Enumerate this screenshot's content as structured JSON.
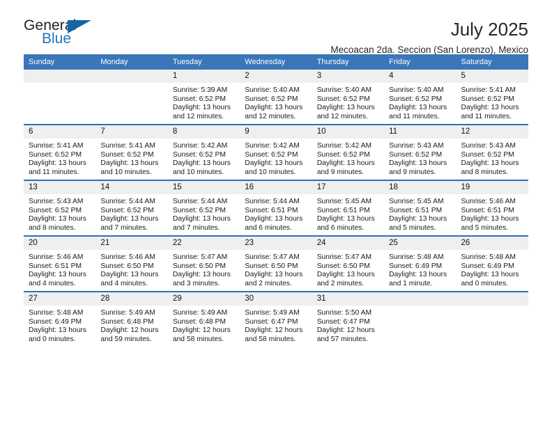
{
  "brand": {
    "name_part1": "General",
    "name_part2": "Blue"
  },
  "header": {
    "title": "July 2025",
    "subtitle": "Mecoacan 2da. Seccion (San Lorenzo), Mexico"
  },
  "colors": {
    "header_blue": "#3a76b8",
    "row_divider_blue": "#2f6fb2",
    "daynum_band": "#efefef",
    "brand_blue": "#1f76bc",
    "text": "#1a1a1a"
  },
  "calendar": {
    "weekday_headers": [
      "Sunday",
      "Monday",
      "Tuesday",
      "Wednesday",
      "Thursday",
      "Friday",
      "Saturday"
    ],
    "weeks": [
      [
        {
          "day": "",
          "empty": true
        },
        {
          "day": "",
          "empty": true
        },
        {
          "day": "1",
          "sunrise": "Sunrise: 5:39 AM",
          "sunset": "Sunset: 6:52 PM",
          "daylight": "Daylight: 13 hours and 12 minutes."
        },
        {
          "day": "2",
          "sunrise": "Sunrise: 5:40 AM",
          "sunset": "Sunset: 6:52 PM",
          "daylight": "Daylight: 13 hours and 12 minutes."
        },
        {
          "day": "3",
          "sunrise": "Sunrise: 5:40 AM",
          "sunset": "Sunset: 6:52 PM",
          "daylight": "Daylight: 13 hours and 12 minutes."
        },
        {
          "day": "4",
          "sunrise": "Sunrise: 5:40 AM",
          "sunset": "Sunset: 6:52 PM",
          "daylight": "Daylight: 13 hours and 11 minutes."
        },
        {
          "day": "5",
          "sunrise": "Sunrise: 5:41 AM",
          "sunset": "Sunset: 6:52 PM",
          "daylight": "Daylight: 13 hours and 11 minutes."
        }
      ],
      [
        {
          "day": "6",
          "sunrise": "Sunrise: 5:41 AM",
          "sunset": "Sunset: 6:52 PM",
          "daylight": "Daylight: 13 hours and 11 minutes."
        },
        {
          "day": "7",
          "sunrise": "Sunrise: 5:41 AM",
          "sunset": "Sunset: 6:52 PM",
          "daylight": "Daylight: 13 hours and 10 minutes."
        },
        {
          "day": "8",
          "sunrise": "Sunrise: 5:42 AM",
          "sunset": "Sunset: 6:52 PM",
          "daylight": "Daylight: 13 hours and 10 minutes."
        },
        {
          "day": "9",
          "sunrise": "Sunrise: 5:42 AM",
          "sunset": "Sunset: 6:52 PM",
          "daylight": "Daylight: 13 hours and 10 minutes."
        },
        {
          "day": "10",
          "sunrise": "Sunrise: 5:42 AM",
          "sunset": "Sunset: 6:52 PM",
          "daylight": "Daylight: 13 hours and 9 minutes."
        },
        {
          "day": "11",
          "sunrise": "Sunrise: 5:43 AM",
          "sunset": "Sunset: 6:52 PM",
          "daylight": "Daylight: 13 hours and 9 minutes."
        },
        {
          "day": "12",
          "sunrise": "Sunrise: 5:43 AM",
          "sunset": "Sunset: 6:52 PM",
          "daylight": "Daylight: 13 hours and 8 minutes."
        }
      ],
      [
        {
          "day": "13",
          "sunrise": "Sunrise: 5:43 AM",
          "sunset": "Sunset: 6:52 PM",
          "daylight": "Daylight: 13 hours and 8 minutes."
        },
        {
          "day": "14",
          "sunrise": "Sunrise: 5:44 AM",
          "sunset": "Sunset: 6:52 PM",
          "daylight": "Daylight: 13 hours and 7 minutes."
        },
        {
          "day": "15",
          "sunrise": "Sunrise: 5:44 AM",
          "sunset": "Sunset: 6:52 PM",
          "daylight": "Daylight: 13 hours and 7 minutes."
        },
        {
          "day": "16",
          "sunrise": "Sunrise: 5:44 AM",
          "sunset": "Sunset: 6:51 PM",
          "daylight": "Daylight: 13 hours and 6 minutes."
        },
        {
          "day": "17",
          "sunrise": "Sunrise: 5:45 AM",
          "sunset": "Sunset: 6:51 PM",
          "daylight": "Daylight: 13 hours and 6 minutes."
        },
        {
          "day": "18",
          "sunrise": "Sunrise: 5:45 AM",
          "sunset": "Sunset: 6:51 PM",
          "daylight": "Daylight: 13 hours and 5 minutes."
        },
        {
          "day": "19",
          "sunrise": "Sunrise: 5:46 AM",
          "sunset": "Sunset: 6:51 PM",
          "daylight": "Daylight: 13 hours and 5 minutes."
        }
      ],
      [
        {
          "day": "20",
          "sunrise": "Sunrise: 5:46 AM",
          "sunset": "Sunset: 6:51 PM",
          "daylight": "Daylight: 13 hours and 4 minutes."
        },
        {
          "day": "21",
          "sunrise": "Sunrise: 5:46 AM",
          "sunset": "Sunset: 6:50 PM",
          "daylight": "Daylight: 13 hours and 4 minutes."
        },
        {
          "day": "22",
          "sunrise": "Sunrise: 5:47 AM",
          "sunset": "Sunset: 6:50 PM",
          "daylight": "Daylight: 13 hours and 3 minutes."
        },
        {
          "day": "23",
          "sunrise": "Sunrise: 5:47 AM",
          "sunset": "Sunset: 6:50 PM",
          "daylight": "Daylight: 13 hours and 2 minutes."
        },
        {
          "day": "24",
          "sunrise": "Sunrise: 5:47 AM",
          "sunset": "Sunset: 6:50 PM",
          "daylight": "Daylight: 13 hours and 2 minutes."
        },
        {
          "day": "25",
          "sunrise": "Sunrise: 5:48 AM",
          "sunset": "Sunset: 6:49 PM",
          "daylight": "Daylight: 13 hours and 1 minute."
        },
        {
          "day": "26",
          "sunrise": "Sunrise: 5:48 AM",
          "sunset": "Sunset: 6:49 PM",
          "daylight": "Daylight: 13 hours and 0 minutes."
        }
      ],
      [
        {
          "day": "27",
          "sunrise": "Sunrise: 5:48 AM",
          "sunset": "Sunset: 6:49 PM",
          "daylight": "Daylight: 13 hours and 0 minutes."
        },
        {
          "day": "28",
          "sunrise": "Sunrise: 5:49 AM",
          "sunset": "Sunset: 6:48 PM",
          "daylight": "Daylight: 12 hours and 59 minutes."
        },
        {
          "day": "29",
          "sunrise": "Sunrise: 5:49 AM",
          "sunset": "Sunset: 6:48 PM",
          "daylight": "Daylight: 12 hours and 58 minutes."
        },
        {
          "day": "30",
          "sunrise": "Sunrise: 5:49 AM",
          "sunset": "Sunset: 6:47 PM",
          "daylight": "Daylight: 12 hours and 58 minutes."
        },
        {
          "day": "31",
          "sunrise": "Sunrise: 5:50 AM",
          "sunset": "Sunset: 6:47 PM",
          "daylight": "Daylight: 12 hours and 57 minutes."
        },
        {
          "day": "",
          "empty": true
        },
        {
          "day": "",
          "empty": true
        }
      ]
    ]
  }
}
